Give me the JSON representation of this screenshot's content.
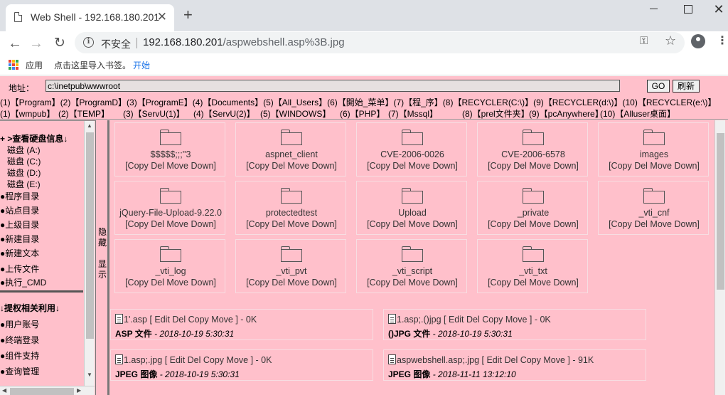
{
  "browser": {
    "tab_title": "Web Shell - 192.168.180.201",
    "tab_close": "✕",
    "new_tab": "+",
    "insecure_label": "不安全",
    "url_host": "192.168.180.201",
    "url_path": "/aspwebshell.asp%3B.jpg",
    "bookmarks": {
      "apps": "应用",
      "import": "点击这里导入书签。",
      "start": "开始"
    }
  },
  "addressbar": {
    "label": "地址：",
    "value": "c:\\inetpub\\wwwroot",
    "go": "GO",
    "refresh": "刷新"
  },
  "quicklinks": {
    "row1": [
      "(1)【Program】",
      "(2)【ProgramD】",
      "(3)【ProgramE】",
      "(4)【Documents】",
      "(5)【All_Users】",
      "(6)【開始_菜单】",
      "(7)【程_序】",
      "(8)【RECYCLER(C:\\)】",
      "(9)【RECYCLER(d:\\)】",
      "(10)【RECYCLER(e:\\)】"
    ],
    "row2": [
      "(1)【wmpub】",
      "(2)【TEMP】",
      "(3)【ServU(1)】",
      "(4)【ServU(2)】",
      "(5)【WINDOWS】",
      "(6)【PHP】",
      "(7)【Mssql】",
      "(8)【prel文件夹】",
      "(9)【pcAnywhere】",
      "(10)【Alluser桌面】"
    ]
  },
  "sidebar": {
    "disk_header": "+ >查看硬盘信息↓",
    "drives": [
      "磁盘 (A:)",
      "磁盘 (C:)",
      "磁盘 (D:)",
      "磁盘 (E:)"
    ],
    "items": [
      "●程序目录",
      "●站点目录",
      "●上级目录",
      "●新建目录",
      "●新建文本",
      "●上传文件",
      "●执行_CMD"
    ],
    "priv_header": "↓提权相关利用↓",
    "priv_items": [
      "●用户账号",
      "●终端登录",
      "●组件支持",
      "●查询管理"
    ]
  },
  "toggle": {
    "hide": "隐藏",
    "show": "显示"
  },
  "directories": [
    {
      "name": "$$$$$;;;''3",
      "actions": "[Copy Del Move Down]"
    },
    {
      "name": "aspnet_client",
      "actions": "[Copy Del Move Down]"
    },
    {
      "name": "CVE-2006-0026",
      "actions": "[Copy Del Move Down]"
    },
    {
      "name": "CVE-2006-6578",
      "actions": "[Copy Del Move Down]"
    },
    {
      "name": "images",
      "actions": "[Copy Del Move Down]"
    },
    {
      "name": "jQuery-File-Upload-9.22.0",
      "actions": "[Copy Del Move Down]"
    },
    {
      "name": "protectedtest",
      "actions": "[Copy Del Move Down]"
    },
    {
      "name": "Upload",
      "actions": "[Copy Del Move Down]"
    },
    {
      "name": "_private",
      "actions": "[Copy Del Move Down]"
    },
    {
      "name": "_vti_cnf",
      "actions": "[Copy Del Move Down]"
    },
    {
      "name": "_vti_log",
      "actions": "[Copy Del Move Down]"
    },
    {
      "name": "_vti_pvt",
      "actions": "[Copy Del Move Down]"
    },
    {
      "name": "_vti_script",
      "actions": "[Copy Del Move Down]"
    },
    {
      "name": "_vti_txt",
      "actions": "[Copy Del Move Down]"
    }
  ],
  "files": [
    {
      "name": "1'.asp",
      "actions": " [ Edit Del Copy Move ] - 0K",
      "type": "ASP 文件",
      "date": " - 2018-10-19 5:30:31"
    },
    {
      "name": "1.asp;.()jpg",
      "actions": " [ Edit Del Copy Move ] - 0K",
      "type": "()JPG 文件",
      "date": " - 2018-10-19 5:30:31"
    },
    {
      "name": "1.asp;.jpg",
      "actions": " [ Edit Del Copy Move ] - 0K",
      "type": "JPEG 图像",
      "date": " - 2018-10-19 5:30:31"
    },
    {
      "name": "aspwebshell.asp;.jpg",
      "actions": " [ Edit Del Copy Move ] - 91K",
      "type": "JPEG 图像",
      "date": " - 2018-11-11 13:12:10"
    }
  ]
}
